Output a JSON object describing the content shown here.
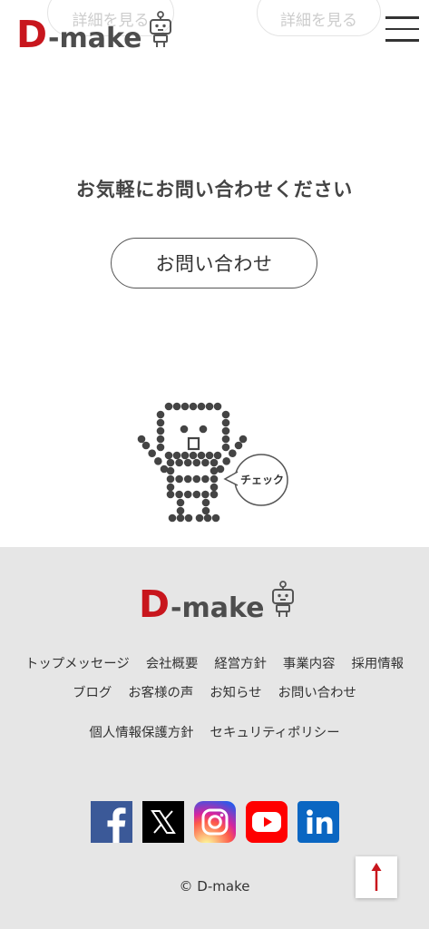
{
  "brand": {
    "mark": "D",
    "word": "-make"
  },
  "colors": {
    "brand_red": "#c8161d",
    "text": "#444444",
    "footer_bg": "#e6e6e6",
    "facebook": "#3b5998",
    "x": "#000000",
    "youtube": "#ff0000",
    "linkedin": "#0a66c2"
  },
  "top_cards": {
    "left_button": "詳細を見る",
    "right_button": "詳細を見る"
  },
  "header": {
    "logo_icon": "robot-icon",
    "menu_icon": "hamburger-icon"
  },
  "contact": {
    "heading": "お気軽にお問い合わせください",
    "button_label": "お問い合わせ"
  },
  "mascot": {
    "icon": "robot-mascot-icon",
    "bubble_text": "チェック"
  },
  "footer": {
    "nav_rows": [
      [
        "トップメッセージ",
        "会社概要",
        "経営方針",
        "事業内容",
        "採用情報"
      ],
      [
        "ブログ",
        "お客様の声",
        "お知らせ",
        "お問い合わせ"
      ]
    ],
    "policy_links": [
      "個人情報保護方針",
      "セキュリティポリシー"
    ],
    "social": [
      {
        "icon": "facebook-icon"
      },
      {
        "icon": "x-icon"
      },
      {
        "icon": "instagram-icon"
      },
      {
        "icon": "youtube-icon"
      },
      {
        "icon": "linkedin-icon"
      }
    ],
    "copyright": "© D-make",
    "back_to_top_icon": "arrow-up-icon"
  }
}
